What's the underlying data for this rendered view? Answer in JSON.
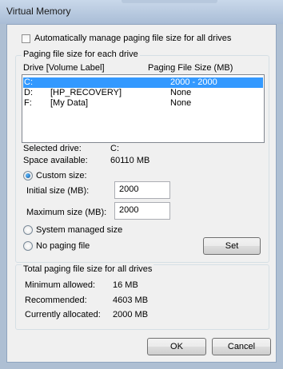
{
  "window": {
    "title": "Virtual Memory"
  },
  "auto_manage": {
    "label": "Automatically manage paging file size for all drives",
    "checked": false
  },
  "paging_group": {
    "title": "Paging file size for each drive",
    "header_drive": "Drive  [Volume Label]",
    "header_size": "Paging File Size (MB)",
    "rows": [
      {
        "drive": "C:",
        "label": "",
        "size": "2000 - 2000",
        "selected": true
      },
      {
        "drive": "D:",
        "label": "[HP_RECOVERY]",
        "size": "None",
        "selected": false
      },
      {
        "drive": "F:",
        "label": "[My Data]",
        "size": "None",
        "selected": false
      }
    ],
    "selected_drive_label": "Selected drive:",
    "selected_drive_value": "C:",
    "space_available_label": "Space available:",
    "space_available_value": "60110 MB",
    "custom_size_label": "Custom size:",
    "initial_size_label": "Initial size (MB):",
    "initial_size_value": "2000",
    "maximum_size_label": "Maximum size (MB):",
    "maximum_size_value": "2000",
    "system_managed_label": "System managed size",
    "no_paging_label": "No paging file",
    "set_label": "Set",
    "selected_option": "custom"
  },
  "totals_group": {
    "title": "Total paging file size for all drives",
    "minimum_label": "Minimum allowed:",
    "minimum_value": "16 MB",
    "recommended_label": "Recommended:",
    "recommended_value": "4603 MB",
    "allocated_label": "Currently allocated:",
    "allocated_value": "2000 MB"
  },
  "buttons": {
    "ok": "OK",
    "cancel": "Cancel"
  }
}
